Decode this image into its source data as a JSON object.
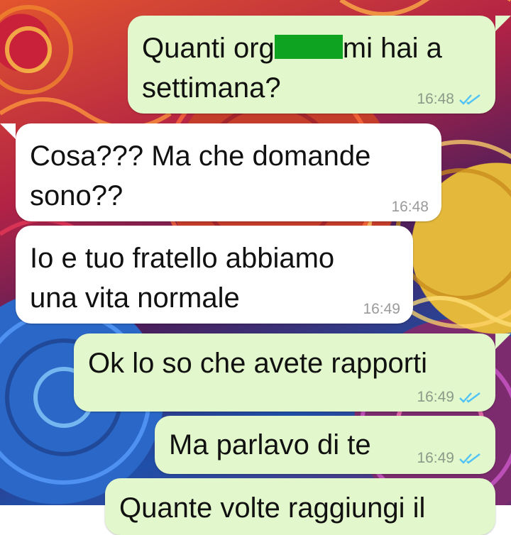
{
  "messages": [
    {
      "direction": "outgoing",
      "text_before": "Quanti org",
      "redacted": "",
      "text_after": "mi hai a\nsettimana?",
      "time": "16:48",
      "status": "read"
    },
    {
      "direction": "incoming",
      "text": "Cosa??? Ma che domande\nsono??",
      "time": "16:48"
    },
    {
      "direction": "incoming",
      "text": "Io e tuo fratello abbiamo\nuna vita normale",
      "time": "16:49"
    },
    {
      "direction": "outgoing",
      "text": "Ok lo so che avete rapporti",
      "time": "16:49",
      "status": "read"
    },
    {
      "direction": "outgoing",
      "text": "Ma parlavo di te",
      "time": "16:49",
      "status": "read"
    },
    {
      "direction": "outgoing",
      "text": "Quante volte raggiungi il",
      "time": "",
      "status": "partial"
    }
  ],
  "colors": {
    "outgoing_bubble": "#e2f7cb",
    "incoming_bubble": "#ffffff",
    "read_ticks": "#4fc3f7",
    "redaction": "#0ea321"
  },
  "icons": {
    "read_receipt": "double-check-icon"
  }
}
